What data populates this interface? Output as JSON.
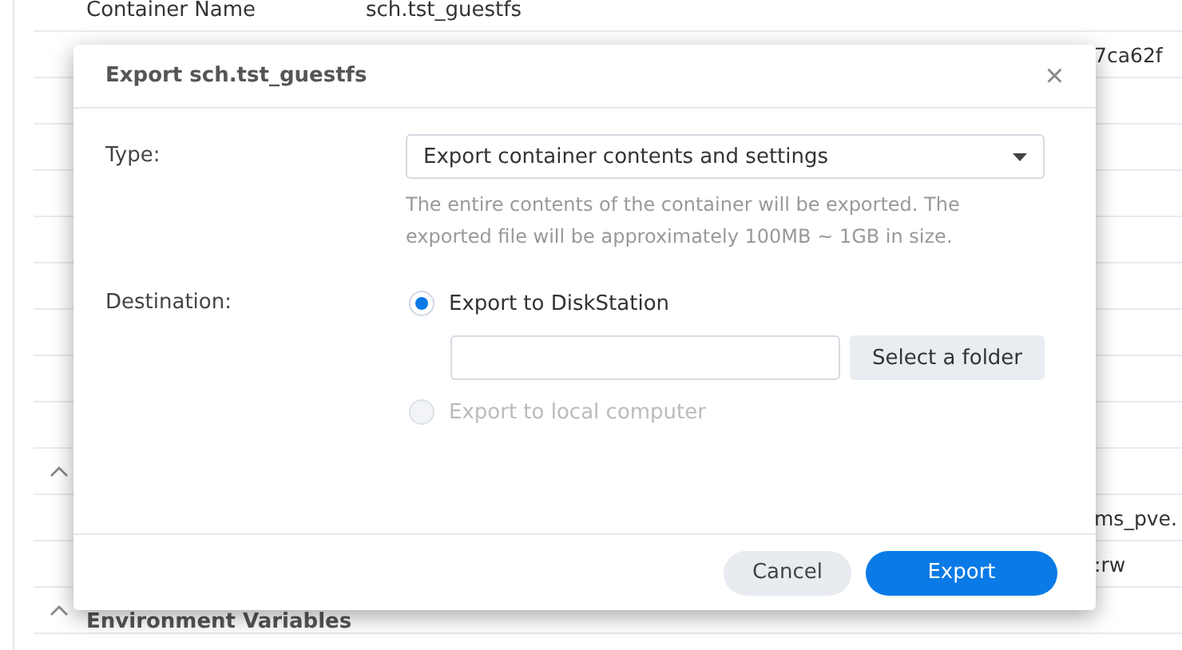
{
  "background": {
    "rows": [
      {
        "kind": "field",
        "label": "Container Name",
        "value": "sch.tst_guestfs"
      },
      {
        "kind": "field",
        "value_right": "7ca62f"
      },
      {
        "kind": "field"
      },
      {
        "kind": "field"
      },
      {
        "kind": "field"
      },
      {
        "kind": "field"
      },
      {
        "kind": "field"
      },
      {
        "kind": "field"
      },
      {
        "kind": "field"
      },
      {
        "kind": "field"
      },
      {
        "kind": "section",
        "expanded": true
      },
      {
        "kind": "field",
        "value_right": "ms_pve."
      },
      {
        "kind": "field",
        "value_right": ":rw"
      },
      {
        "kind": "section",
        "expanded": true,
        "title": "Environment Variables"
      }
    ]
  },
  "dialog": {
    "title": "Export sch.tst_guestfs",
    "close": "×",
    "type_label": "Type:",
    "type_value": "Export container contents and settings",
    "hint": "The entire contents of the container will be exported. The exported file will be approximately 100MB ~ 1GB in size.",
    "destination_label": "Destination:",
    "options": [
      {
        "label": "Export to DiskStation",
        "selected": true,
        "disabled": false
      },
      {
        "label": "Export to local computer",
        "selected": false,
        "disabled": true
      }
    ],
    "folder_button": "Select a folder",
    "buttons": [
      {
        "label": "Cancel",
        "kind": "secondary"
      },
      {
        "label": "Export",
        "kind": "primary"
      }
    ]
  }
}
